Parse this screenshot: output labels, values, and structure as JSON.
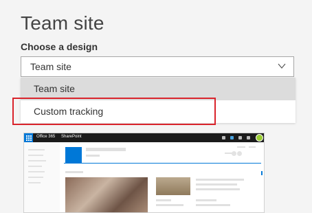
{
  "page": {
    "title": "Team site"
  },
  "form": {
    "design_label": "Choose a design",
    "selected_value": "Team site",
    "options": [
      {
        "label": "Team site"
      },
      {
        "label": "Custom tracking"
      }
    ]
  },
  "preview": {
    "app_name": "Office 365",
    "product_name": "SharePoint"
  },
  "colors": {
    "accent": "#0078d7",
    "highlight_border": "#d9232b",
    "suite_bar": "#1b1b1b"
  },
  "icons": [
    "chevron-down-icon",
    "waffle-icon",
    "avatar-icon"
  ]
}
